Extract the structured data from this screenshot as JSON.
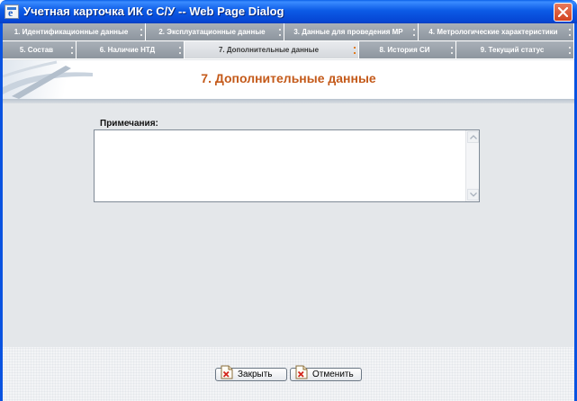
{
  "window": {
    "title": "Учетная карточка ИК с С/У -- Web Page Dialog"
  },
  "tabs": {
    "row1": [
      {
        "label": "1. Идентификационные данные",
        "active": false
      },
      {
        "label": "2. Эксплуатационные данные",
        "active": false
      },
      {
        "label": "3. Данные для проведения МР",
        "active": false
      },
      {
        "label": "4. Метрологические характеристики",
        "active": false
      }
    ],
    "row2": [
      {
        "label": "5. Состав",
        "active": false
      },
      {
        "label": "6. Наличие НТД",
        "active": false
      },
      {
        "label": "7. Дополнительные данные",
        "active": true
      },
      {
        "label": "8. История СИ",
        "active": false
      },
      {
        "label": "9. Текущий статус",
        "active": false
      }
    ]
  },
  "banner": {
    "title": "7. Дополнительные данные"
  },
  "form": {
    "notes_label": "Примечания:",
    "notes_value": ""
  },
  "footer": {
    "close_label": "Закрыть",
    "cancel_label": "Отменить"
  },
  "colors": {
    "title_bar": "#0a5fe8",
    "tab_inactive": "#9aa1a9",
    "tab_active": "#e0e3e6",
    "heading_accent": "#c45a1a",
    "client_bg": "#e4e7ea"
  },
  "icons": {
    "app": "ie-page-icon",
    "close": "close-icon",
    "button_doc": "document-x-icon"
  }
}
